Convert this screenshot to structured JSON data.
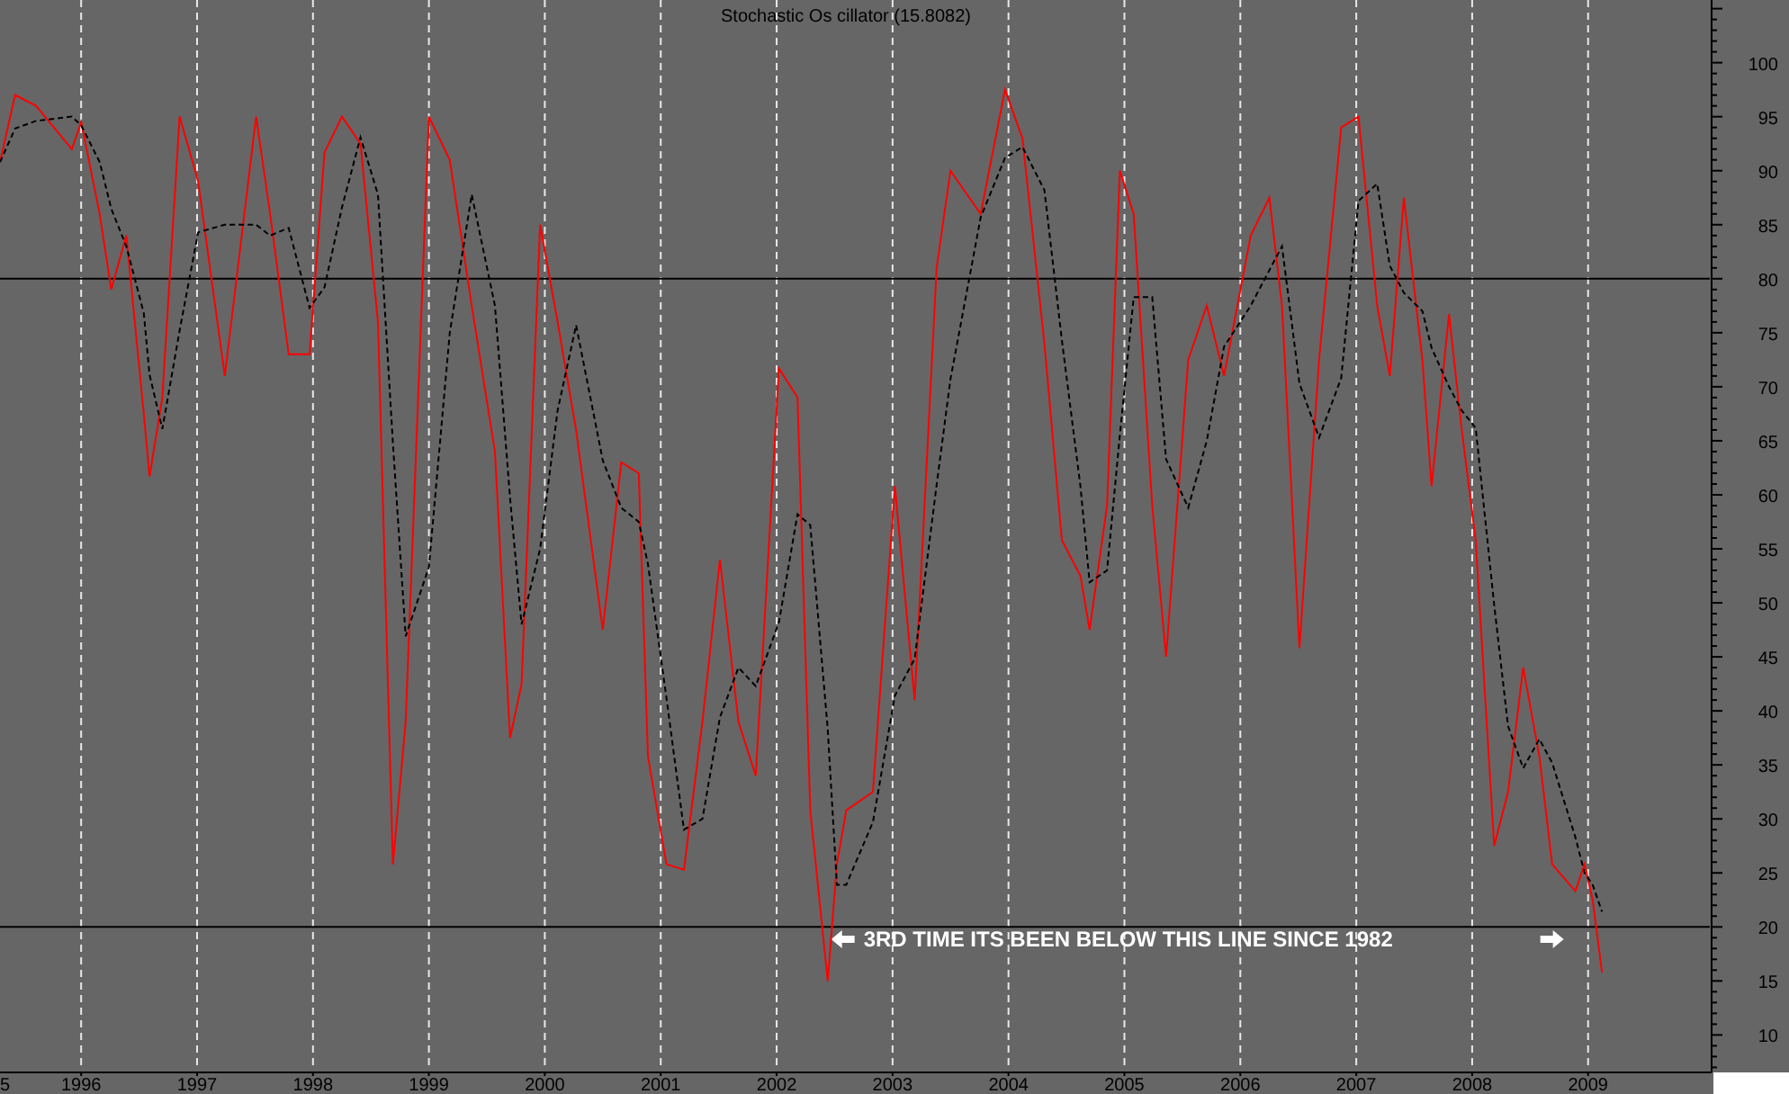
{
  "chart": {
    "chart_data": {
      "type": "line",
      "title": "Stochastic Os cillator (15.8082)",
      "xlim": [
        1995.3,
        2010.05
      ],
      "grid": true,
      "ylim": [
        6.7,
        105.8
      ],
      "xticks": [
        1996,
        1997,
        1998,
        1999,
        2000,
        2001,
        2002,
        2003,
        2004,
        2005,
        2006,
        2007,
        2008,
        2009
      ],
      "yticks": [
        10,
        15,
        20,
        25,
        30,
        35,
        40,
        45,
        50,
        55,
        60,
        65,
        70,
        75,
        80,
        85,
        90,
        95,
        100
      ],
      "x": [
        1995.3,
        1995.43,
        1995.61,
        1995.92,
        1996.0,
        1996.16,
        1996.26,
        1996.39,
        1996.54,
        1996.59,
        1996.7,
        1996.85,
        1997.01,
        1997.24,
        1997.51,
        1997.63,
        1997.79,
        1997.97,
        1998.1,
        1998.25,
        1998.41,
        1998.56,
        1998.69,
        1998.8,
        1999.0,
        1999.18,
        1999.37,
        1999.57,
        1999.7,
        1999.8,
        1999.96,
        2000.11,
        2000.27,
        2000.5,
        2000.66,
        2000.81,
        2000.89,
        2001.05,
        2001.2,
        2001.36,
        2001.51,
        2001.67,
        2001.82,
        2002.02,
        2002.18,
        2002.29,
        2002.44,
        2002.52,
        2002.6,
        2002.83,
        2003.02,
        2003.19,
        2003.38,
        2003.5,
        2003.76,
        2003.97,
        2004.12,
        2004.31,
        2004.46,
        2004.62,
        2004.7,
        2004.85,
        2004.96,
        2005.08,
        2005.24,
        2005.36,
        2005.55,
        2005.71,
        2005.86,
        2006.09,
        2006.25,
        2006.36,
        2006.51,
        2006.68,
        2006.87,
        2007.02,
        2007.18,
        2007.29,
        2007.41,
        2007.57,
        2007.65,
        2007.8,
        2007.91,
        2008.03,
        2008.19,
        2008.31,
        2008.44,
        2008.58,
        2008.69,
        2008.89,
        2008.97,
        2009.04,
        2009.12
      ],
      "series": [
        {
          "color": "#ff0000",
          "line_style": "solid",
          "values": [
            90.8,
            97,
            96,
            92,
            94.5,
            86,
            79,
            84,
            67.5,
            61.7,
            69,
            95,
            89,
            71,
            95,
            86,
            73,
            73,
            91.7,
            95,
            92.5,
            76,
            25.8,
            39,
            95,
            91,
            77.5,
            64,
            37.5,
            42.5,
            85,
            76,
            66,
            47.5,
            63,
            62,
            35.8,
            25.8,
            25.3,
            39,
            54,
            39,
            34,
            71.7,
            69,
            30.8,
            15,
            25.8,
            30.8,
            32.5,
            60.8,
            41,
            81,
            90,
            86,
            97.5,
            93,
            74,
            55.8,
            52.5,
            47.5,
            59,
            90,
            86,
            59,
            45,
            72.5,
            77.5,
            71,
            84,
            87.5,
            77.5,
            45.8,
            72.5,
            94,
            95,
            77.5,
            71,
            87.5,
            72.5,
            60.8,
            76.7,
            66,
            55.8,
            27.5,
            32.5,
            44,
            35.8,
            25.8,
            23.3,
            25.8,
            22.5,
            15.8
          ]
        },
        {
          "color": "#000000",
          "line_style": "dashed",
          "values": [
            90.8,
            93.9,
            94.6,
            95,
            94.2,
            90.8,
            86.5,
            83,
            76.8,
            71.1,
            66.1,
            75.2,
            84.3,
            85,
            85,
            84,
            84.7,
            77.3,
            79.2,
            86.6,
            93.1,
            87.8,
            64.8,
            46.9,
            53.3,
            75,
            87.8,
            77.5,
            59.7,
            48,
            55,
            67.8,
            75.7,
            63.2,
            58.8,
            57.5,
            53.6,
            41.2,
            29,
            30,
            39.4,
            44,
            42.3,
            48.2,
            58.2,
            57.2,
            38.3,
            23.9,
            23.9,
            29.7,
            41.4,
            44.8,
            60.9,
            70.7,
            85.7,
            91.2,
            92.2,
            88.2,
            74.3,
            60.8,
            51.9,
            53,
            65.5,
            78.3,
            78.3,
            63.3,
            58.8,
            65,
            73.7,
            77.5,
            80.8,
            83,
            70.3,
            65.3,
            70.8,
            87.2,
            88.8,
            81.2,
            78.7,
            77,
            73.6,
            70,
            67.8,
            66.2,
            49.8,
            38.6,
            34.7,
            37.4,
            35.2,
            28.3,
            25,
            23.9,
            21.4
          ]
        }
      ],
      "ref_lines": [
        {
          "axis": "y",
          "value": 80
        },
        {
          "axis": "y",
          "value": 20
        }
      ],
      "annotations": [
        "3RD TIME ITS BEEN BELOW THIS LINE SINCE 1982"
      ]
    },
    "clipped_x_label": "5"
  }
}
